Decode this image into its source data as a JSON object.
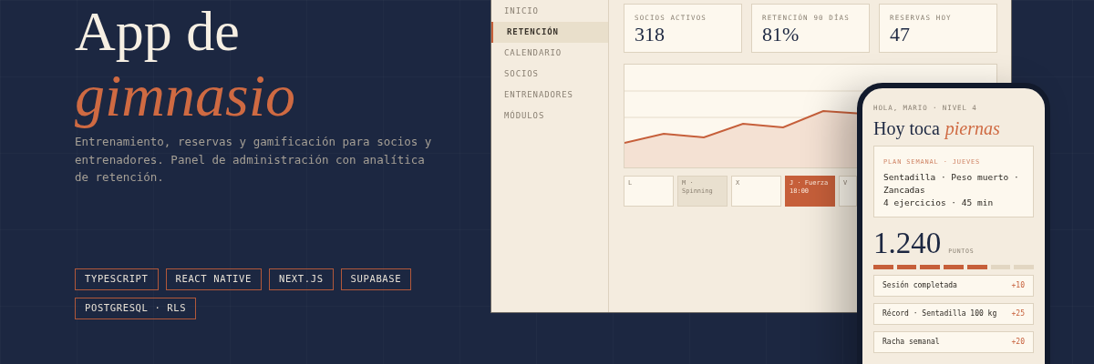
{
  "hero": {
    "title": "App de",
    "title_accent": "gimnasio",
    "description": "Entrenamiento, reservas y gamificación para socios y entrenadores. Panel de administración con analítica de retención.",
    "tags": [
      "TYPESCRIPT",
      "REACT NATIVE",
      "NEXT.JS",
      "SUPABASE",
      "POSTGRESQL · RLS"
    ]
  },
  "dashboard": {
    "nav": [
      {
        "label": "INICIO",
        "selected": false
      },
      {
        "label": "RETENCIÓN",
        "selected": true
      },
      {
        "label": "CALENDARIO",
        "selected": false
      },
      {
        "label": "SOCIOS",
        "selected": false
      },
      {
        "label": "ENTRENADORES",
        "selected": false
      },
      {
        "label": "MÓDULOS",
        "selected": false
      }
    ],
    "stats": [
      {
        "label": "SOCIOS ACTIVOS",
        "value": "318"
      },
      {
        "label": "RETENCIÓN 90 DÍAS",
        "value": "81%"
      },
      {
        "label": "RESERVAS HOY",
        "value": "47"
      }
    ],
    "days": [
      {
        "label": "L",
        "kind": "free"
      },
      {
        "label": "M · Spinning",
        "kind": "booked"
      },
      {
        "label": "X",
        "kind": "free"
      },
      {
        "label": "J · Fuerza 18:00",
        "kind": "today"
      },
      {
        "label": "V",
        "kind": "free"
      }
    ]
  },
  "phone": {
    "greeting": "HOLA, MARIO · NIVEL 4",
    "title": "Hoy toca",
    "title_accent": "piernas",
    "plan": {
      "label": "PLAN SEMANAL · JUEVES",
      "exercises": "Sentadilla · Peso muerto · Zancadas",
      "summary": "4 ejercicios · 45 min"
    },
    "points": "1.240",
    "points_label": "PUNTOS",
    "progress": {
      "level": 0.71
    },
    "rewards": [
      {
        "label": "Sesión completada",
        "points": "+10"
      },
      {
        "label": "Récord · Sentadilla 100 kg",
        "points": "+25"
      },
      {
        "label": "Racha semanal",
        "points": "+20"
      }
    ]
  }
}
